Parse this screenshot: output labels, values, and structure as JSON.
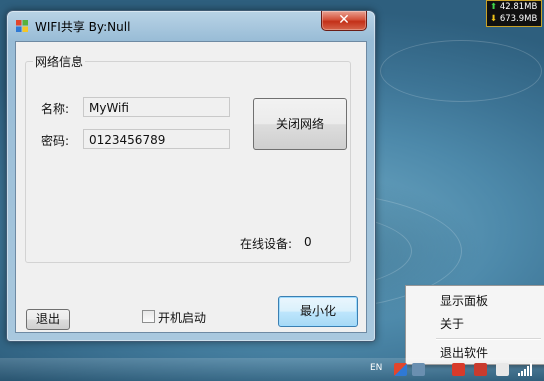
{
  "window": {
    "title": "WIFI共享 By:Null",
    "close_glyph": "✕"
  },
  "network_group": {
    "label": "网络信息",
    "name_label": "名称:",
    "name_value": "MyWifi",
    "password_label": "密码:",
    "password_value": "0123456789",
    "close_network_button": "关闭网络",
    "online_devices_label": "在线设备:",
    "online_devices_count": "0"
  },
  "footer": {
    "exit_button": "退出",
    "autostart_label": "开机启动",
    "autostart_checked": false,
    "minimize_button": "最小化"
  },
  "netmon": {
    "upload": "42.81MB",
    "download": "673.9MB",
    "up_glyph": "⬆",
    "down_glyph": "⬇"
  },
  "context_menu": {
    "items": [
      "显示面板",
      "关于"
    ],
    "exit_item": "退出软件"
  },
  "taskbar": {
    "language": "EN"
  }
}
